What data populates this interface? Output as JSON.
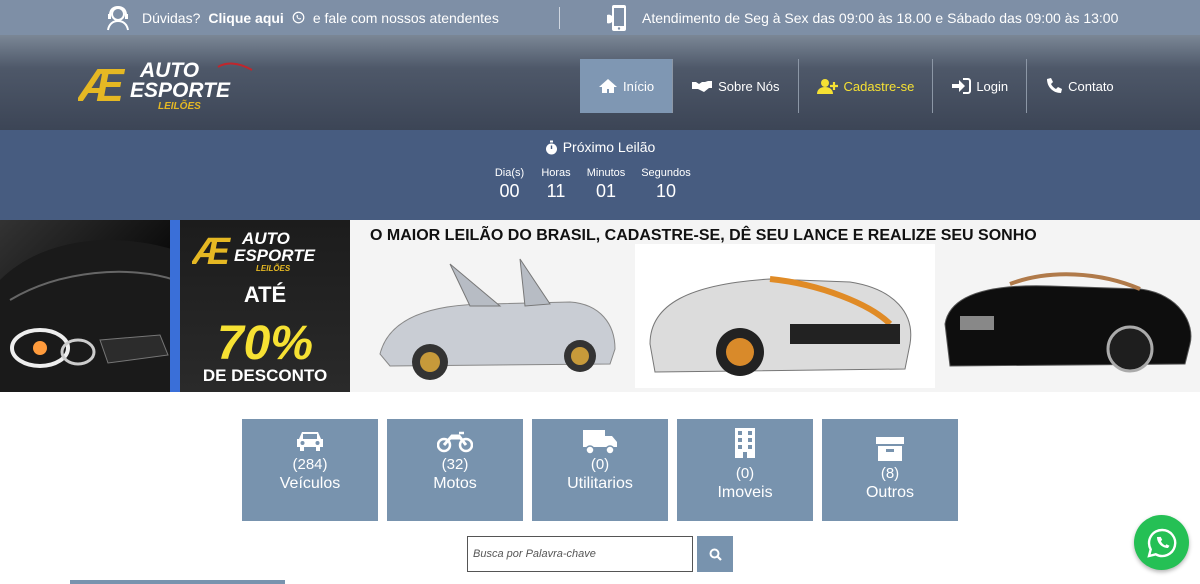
{
  "topbar": {
    "help_prefix": "Dúvidas?",
    "help_link": "Clique aqui",
    "help_suffix": "e fale com nossos atendentes",
    "hours": "Atendimento de Seg à Sex das 09:00 às 18.00 e Sábado das 09:00 às 13:00"
  },
  "logo": {
    "line1": "AUTO",
    "line2": "ESPORTE",
    "line3": "LEILÕES",
    "mark": "Æ"
  },
  "nav": [
    {
      "label": "Início",
      "icon": "home-icon"
    },
    {
      "label": "Sobre Nós",
      "icon": "handshake-icon"
    },
    {
      "label": "Cadastre-se",
      "icon": "user-plus-icon"
    },
    {
      "label": "Login",
      "icon": "sign-in-icon"
    },
    {
      "label": "Contato",
      "icon": "phone-icon"
    }
  ],
  "countdown": {
    "title": "Próximo Leilão",
    "units": [
      {
        "label": "Dia(s)",
        "value": "00"
      },
      {
        "label": "Horas",
        "value": "11"
      },
      {
        "label": "Minutos",
        "value": "01"
      },
      {
        "label": "Segundos",
        "value": "10"
      }
    ]
  },
  "banner": {
    "logo_line1": "AUTO",
    "logo_line2": "ESPORTE",
    "logo_line3": "LEILÕES",
    "promo_ate": "ATÉ",
    "promo_pct": "70%",
    "promo_desc": "DE DESCONTO",
    "headline": "O MAIOR LEILÃO DO BRASIL, CADASTRE-SE, DÊ SEU LANCE E REALIZE SEU SONHO"
  },
  "categories": [
    {
      "count": "(284)",
      "name": "Veículos",
      "icon": "car-icon"
    },
    {
      "count": "(32)",
      "name": "Motos",
      "icon": "motorcycle-icon"
    },
    {
      "count": "(0)",
      "name": "Utilitarios",
      "icon": "truck-icon"
    },
    {
      "count": "(0)",
      "name": "Imoveis",
      "icon": "building-icon"
    },
    {
      "count": "(8)",
      "name": "Outros",
      "icon": "archive-icon"
    }
  ],
  "search": {
    "placeholder": "Busca por Palavra-chave"
  },
  "colors": {
    "topbar": "#7e8fa6",
    "countdown": "#475c80",
    "category": "#7893ae",
    "accent_yellow": "#f6e133",
    "whatsapp": "#25c055"
  }
}
